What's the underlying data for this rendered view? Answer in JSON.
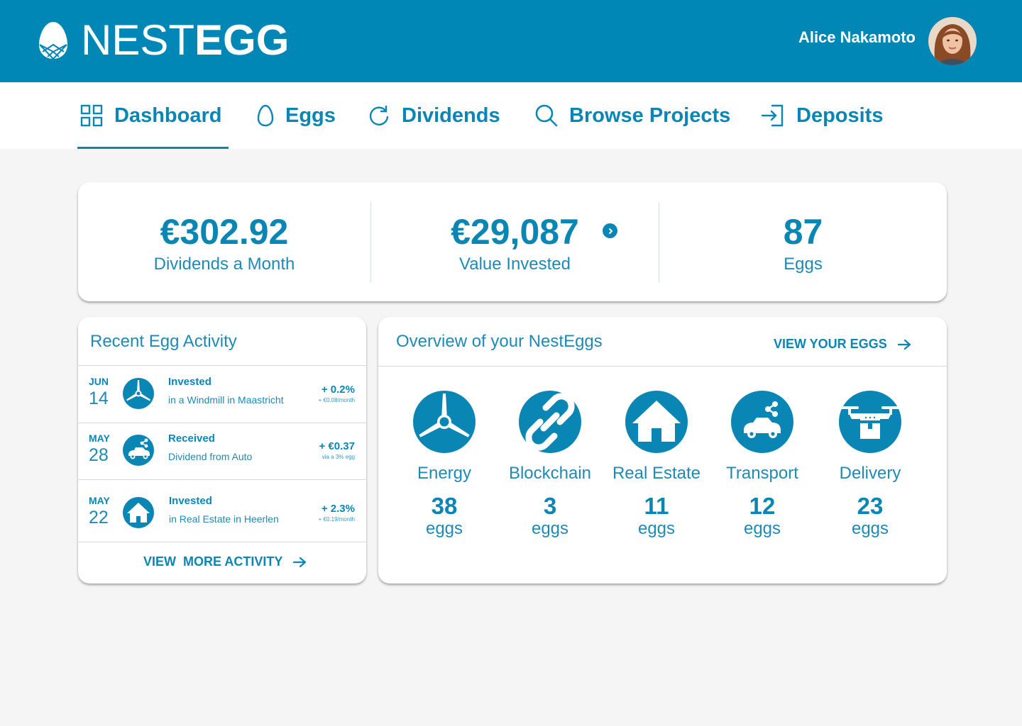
{
  "brand": {
    "name_thin": "NEST",
    "name_bold": "EGG",
    "primary_color": "#0087b5",
    "text_color": "#0a86b4"
  },
  "user": {
    "name": "Alice Nakamoto"
  },
  "nav": {
    "items": [
      {
        "label": "Dashboard",
        "icon": "grid-icon",
        "active": true
      },
      {
        "label": "Eggs",
        "icon": "egg-icon"
      },
      {
        "label": "Dividends",
        "icon": "refresh-icon"
      },
      {
        "label": "Browse Projects",
        "icon": "search-icon"
      },
      {
        "label": "Deposits",
        "icon": "sign-in-icon"
      }
    ]
  },
  "stats": [
    {
      "value": "€302.92",
      "caption": "Dividends a Month"
    },
    {
      "value": "€29,087",
      "caption": "Value Invested"
    },
    {
      "value": "87",
      "caption": "Eggs"
    }
  ],
  "activity": {
    "title": "Recent Egg Activity",
    "rows": [
      {
        "month": "JUN",
        "day": "14",
        "icon": "windmill-icon",
        "type": "Invested",
        "desc": "in a Windmill in Maastricht",
        "amount": "+ 0.2%",
        "sub": "+ €0.08/month"
      },
      {
        "month": "MAY",
        "day": "28",
        "icon": "car-icon",
        "type": "Received",
        "desc": "Dividend from Auto",
        "amount": "+ €0.37",
        "sub": "via a 3% egg"
      },
      {
        "month": "MAY",
        "day": "22",
        "icon": "house-icon",
        "type": "Invested",
        "desc": "in Real Estate in Heerlen",
        "amount": "+ 2.3%",
        "sub": "+ €0.19/month"
      }
    ],
    "more_label": "VIEW  MORE ACTIVITY"
  },
  "overview": {
    "title": "Overview of your NestEggs",
    "link_label": "VIEW YOUR EGGS",
    "unit": "eggs",
    "categories": [
      {
        "name": "Energy",
        "count": "38",
        "icon": "windmill-icon"
      },
      {
        "name": "Blockchain",
        "count": "3",
        "icon": "chain-link-icon"
      },
      {
        "name": "Real Estate",
        "count": "11",
        "icon": "house-icon"
      },
      {
        "name": "Transport",
        "count": "12",
        "icon": "car-icon"
      },
      {
        "name": "Delivery",
        "count": "23",
        "icon": "drone-icon"
      }
    ]
  }
}
